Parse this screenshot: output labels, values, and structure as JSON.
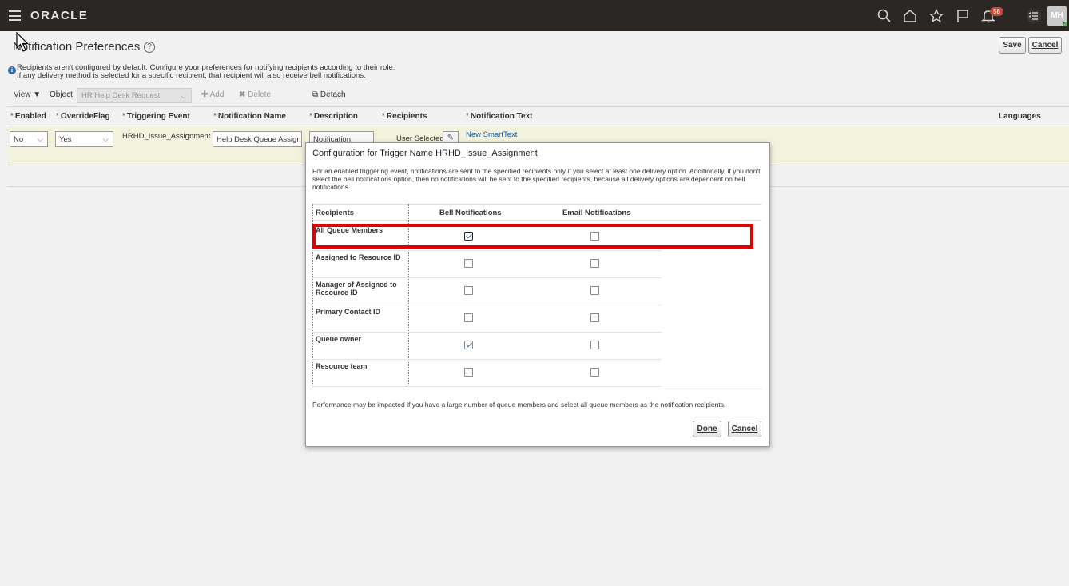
{
  "topbar": {
    "logo": "ORACLE",
    "notification_count": "58",
    "avatar_initials": "MH"
  },
  "page": {
    "title": "Notification Preferences",
    "save_label": "Save",
    "cancel_label": "Cancel",
    "info_line1": "Recipients aren't configured by default. Configure your preferences for notifying recipients according to their role.",
    "info_line2": "If any delivery method is selected for a specific recipient, that recipient will also receive bell notifications."
  },
  "toolbar": {
    "view_label": "View",
    "object_label": "Object",
    "object_value": "HR Help Desk Request",
    "add_label": "Add",
    "delete_label": "Delete",
    "detach_label": "Detach"
  },
  "table": {
    "headers": {
      "enabled": "Enabled",
      "override_flag": "OverrideFlag",
      "triggering_event": "Triggering Event",
      "notification_name": "Notification Name",
      "description": "Description",
      "recipients": "Recipients",
      "notification_text": "Notification Text",
      "languages": "Languages"
    },
    "row": {
      "enabled": "No",
      "override_flag": "Yes",
      "triggering_event": "HRHD_Issue_Assignment",
      "notification_name": "Help Desk Queue Assignm",
      "description": "Notification",
      "recipients": "User Selected",
      "notification_text": "New SmartText"
    }
  },
  "dialog": {
    "title": "Configuration for Trigger Name HRHD_Issue_Assignment",
    "description": "For an enabled triggering event, notifications are sent to the specified recipients only if you select at least one delivery option. Additionally, if you don't select the bell notifications option, then no notifications will be sent to the specified recipients, because all delivery options are dependent on bell notifications.",
    "col_recipients": "Recipients",
    "col_bell": "Bell Notifications",
    "col_email": "Email Notifications",
    "rows": [
      {
        "name": "All Queue Members",
        "bell": true,
        "email": false
      },
      {
        "name": "Assigned to Resource ID",
        "bell": false,
        "email": false
      },
      {
        "name": "Manager of Assigned to Resource ID",
        "bell": false,
        "email": false
      },
      {
        "name": "Primary Contact ID",
        "bell": false,
        "email": false
      },
      {
        "name": "Queue owner",
        "bell": true,
        "email": false
      },
      {
        "name": "Resource team",
        "bell": false,
        "email": false
      }
    ],
    "note": "Performance may be impacted if you have a large number of queue members and select all queue members as the notification recipients.",
    "done_label": "Done",
    "cancel_label": "Cancel"
  },
  "colors": {
    "topbar": "#2a2724",
    "highlight": "#e00000",
    "link": "#145c9e",
    "badge": "#c74634"
  }
}
